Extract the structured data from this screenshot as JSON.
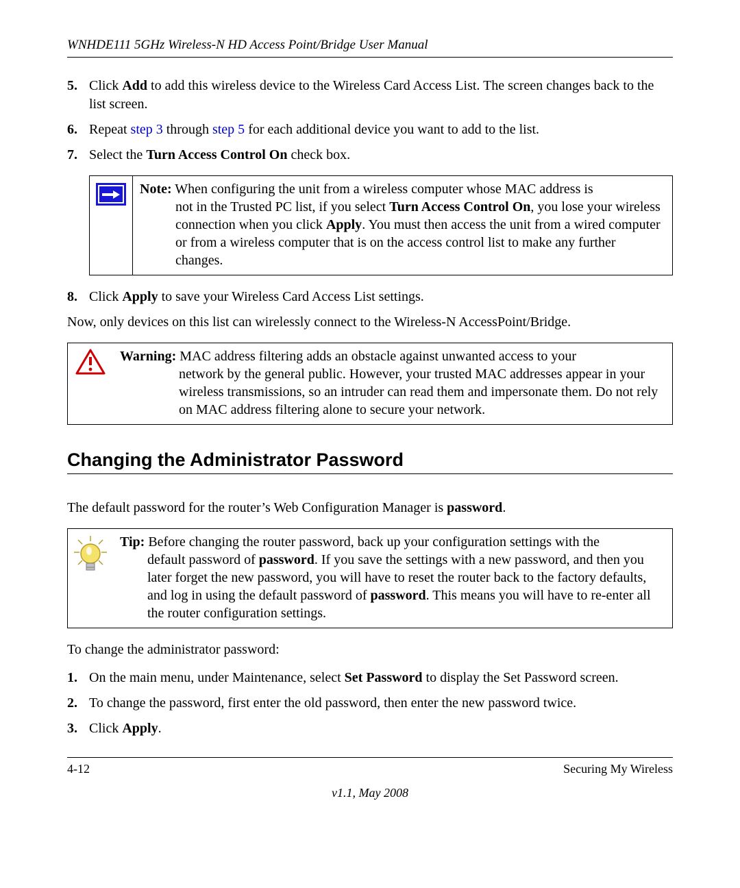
{
  "header": {
    "running_title": "WNHDE111 5GHz Wireless-N HD Access Point/Bridge User Manual"
  },
  "steps_a": [
    {
      "num": "5.",
      "text_pre": "Click ",
      "bold1": "Add",
      "text_post": " to add this wireless device to the Wireless Card Access List. The screen changes back to the list screen."
    },
    {
      "num": "6.",
      "text_pre": "Repeat ",
      "link1": "step 3",
      "mid1": " through ",
      "link2": "step 5",
      "text_post": " for each additional device you want to add to the list."
    },
    {
      "num": "7.",
      "text_pre": "Select the ",
      "bold1": "Turn Access Control On",
      "text_post": " check box."
    }
  ],
  "note": {
    "label": "Note:",
    "first_line": " When configuring the unit from a wireless computer whose MAC address is",
    "body_pre": "not in the Trusted PC list, if you select ",
    "body_b1": "Turn Access Control On",
    "body_mid1": ", you lose your wireless connection when you click ",
    "body_b2": "Apply",
    "body_post": ". You must then access the unit from a wired computer or from a wireless computer that is on the access control list to make any further changes."
  },
  "steps_b": [
    {
      "num": "8.",
      "text_pre": "Click ",
      "bold1": "Apply",
      "text_post": " to save your Wireless Card Access List settings."
    }
  ],
  "para_after_steps": "Now, only devices on this list can wirelessly connect to the Wireless-N AccessPoint/Bridge.",
  "warning": {
    "label": "Warning:",
    "first_line": " MAC address filtering adds an obstacle against unwanted access to your",
    "body": "network by the general public. However, your trusted MAC addresses appear in your wireless transmissions, so an intruder can read them and impersonate them. Do not rely on MAC address filtering alone to secure your network."
  },
  "section_heading": "Changing the Administrator Password",
  "section_intro_pre": "The default password for the router’s Web Configuration Manager is ",
  "section_intro_bold": "password",
  "section_intro_post": ".",
  "tip": {
    "label": "Tip:",
    "first_line": " Before changing the router password, back up your configuration settings with the",
    "body_pre": "default password of ",
    "body_b1": "password",
    "body_mid1": ". If you save the settings with a new password, and then you later forget the new password, you will have to reset the router back to the factory defaults, and log in using the default password of ",
    "body_b2": "password",
    "body_post": ". This means you will have to re-enter all the router configuration settings."
  },
  "para_to_change": "To change the administrator password:",
  "steps_c": [
    {
      "num": "1.",
      "text_pre": "On the main menu, under Maintenance, select ",
      "bold1": "Set Password",
      "text_post": " to display the Set Password screen."
    },
    {
      "num": "2.",
      "text_pre": "To change the password, first enter the old password, then enter the new password twice.",
      "bold1": "",
      "text_post": ""
    },
    {
      "num": "3.",
      "text_pre": "Click ",
      "bold1": "Apply",
      "text_post": "."
    }
  ],
  "footer": {
    "page_num": "4-12",
    "section": "Securing My Wireless",
    "version": "v1.1, May 2008"
  }
}
